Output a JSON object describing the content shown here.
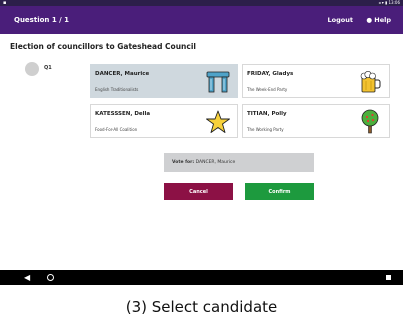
{
  "status_bar": {
    "right": "◂ ▾ ▮ 13:06"
  },
  "header": {
    "question": "Question 1 / 1",
    "logout": "Logout",
    "help": "Help"
  },
  "election": {
    "title": "Election of councillors to Gateshead Council",
    "question_label": "Q1"
  },
  "candidates": [
    {
      "name": "DANCER, Maurice",
      "party": "English Traditionalists",
      "icon": "stonehenge-icon",
      "selected": true
    },
    {
      "name": "FRIDAY, Gladys",
      "party": "The Week-End Party",
      "icon": "beer-mug-icon",
      "selected": false
    },
    {
      "name": "KATESSSEN, Della",
      "party": "Food-For-All Coalition",
      "icon": "star-icon",
      "selected": false
    },
    {
      "name": "TITIAN, Polly",
      "party": "The Working Party",
      "icon": "tree-icon",
      "selected": false
    }
  ],
  "vote": {
    "label": "Vote for:",
    "selected_name": "DANCER, Maurice"
  },
  "buttons": {
    "cancel": "Cancel",
    "confirm": "Confirm"
  },
  "colors": {
    "header": "#4a1e7a",
    "selected_card": "#cfd8de",
    "cancel": "#8c1145",
    "confirm": "#1d9a3e"
  },
  "caption": "(3) Select candidate"
}
